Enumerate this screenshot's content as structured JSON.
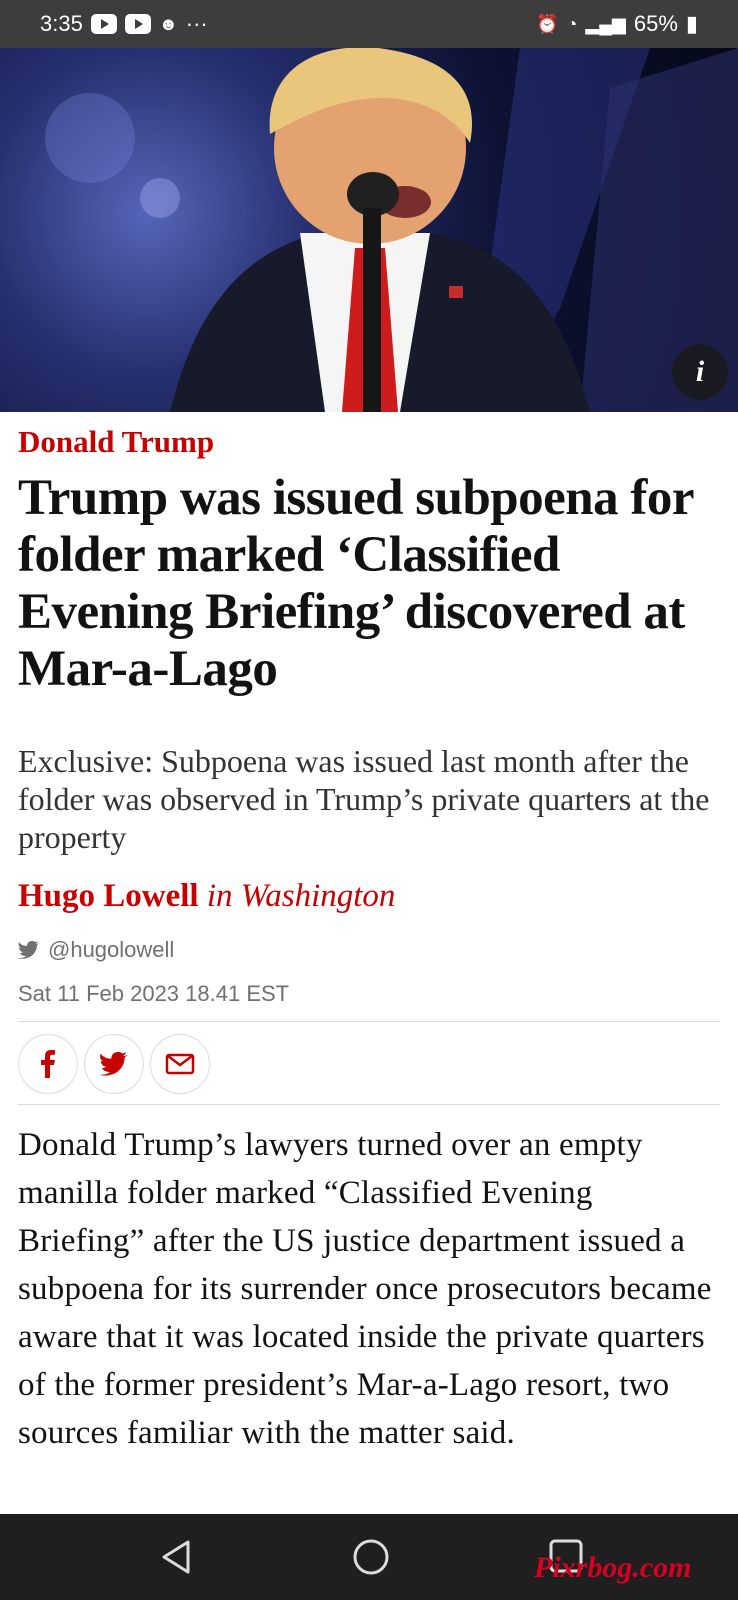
{
  "status_bar": {
    "time": "3:35",
    "extra": "···",
    "battery": "65%",
    "icons": [
      "youtube-icon",
      "youtube-icon",
      "reddit-icon",
      "alarm-icon",
      "wifi-icon",
      "signal-icon",
      "battery-icon"
    ]
  },
  "article": {
    "kicker": "Donald Trump",
    "headline": "Trump was issued subpoena for folder marked ‘Classified Evening Briefing’ discovered at Mar-a-Lago",
    "standfirst": "Exclusive: Subpoena was issued last month after the folder was observed in Trump’s private quarters at the property",
    "author": "Hugo Lowell",
    "location": "in Washington",
    "twitter_handle": "@hugolowell",
    "date": "Sat 11 Feb 2023 18.41 EST",
    "body": "Donald Trump’s lawyers turned over an empty manilla folder marked “Classified Evening Briefing” after the US justice department issued a subpoena for its surrender once prosecutors became aware that it was located inside the private quarters of the former president’s Mar-a-Lago resort, two sources familiar with the matter said."
  },
  "hero": {
    "info_label": "i"
  },
  "share": {
    "icons": [
      "facebook-icon",
      "twitter-icon",
      "email-icon"
    ]
  },
  "watermark": "Pixrbog.com",
  "colors": {
    "accent": "#c70000",
    "status_bar": "#3d3d3d",
    "nav_bar": "#1f1f1f"
  }
}
